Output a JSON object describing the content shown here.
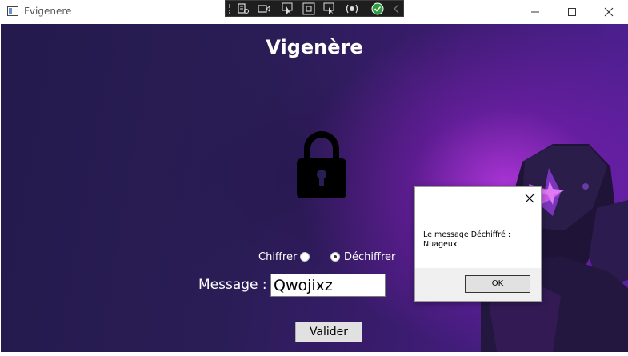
{
  "window": {
    "title": "Fvigenere"
  },
  "debug_toolbar": {
    "icons": [
      "live-visual-tree-icon",
      "record-icon",
      "select-element-icon",
      "display-adorners-icon",
      "track-focus-icon",
      "hot-reload-icon",
      "binding-check-icon",
      "collapse-icon"
    ]
  },
  "app": {
    "title": "Vigenère",
    "mode_options": [
      {
        "label": "Chiffrer",
        "checked": false
      },
      {
        "label": "Déchiffrer",
        "checked": true
      }
    ],
    "message_label": "Message :",
    "message_value": "Qwojixz",
    "submit_label": "Valider"
  },
  "dialog": {
    "message_line1": "Le message Déchiffré :",
    "message_line2": "Nuageux",
    "ok_label": "OK"
  },
  "colors": {
    "background_dark": "#241a4c",
    "background_accent": "#ba37e2",
    "text": "#ffffff"
  }
}
